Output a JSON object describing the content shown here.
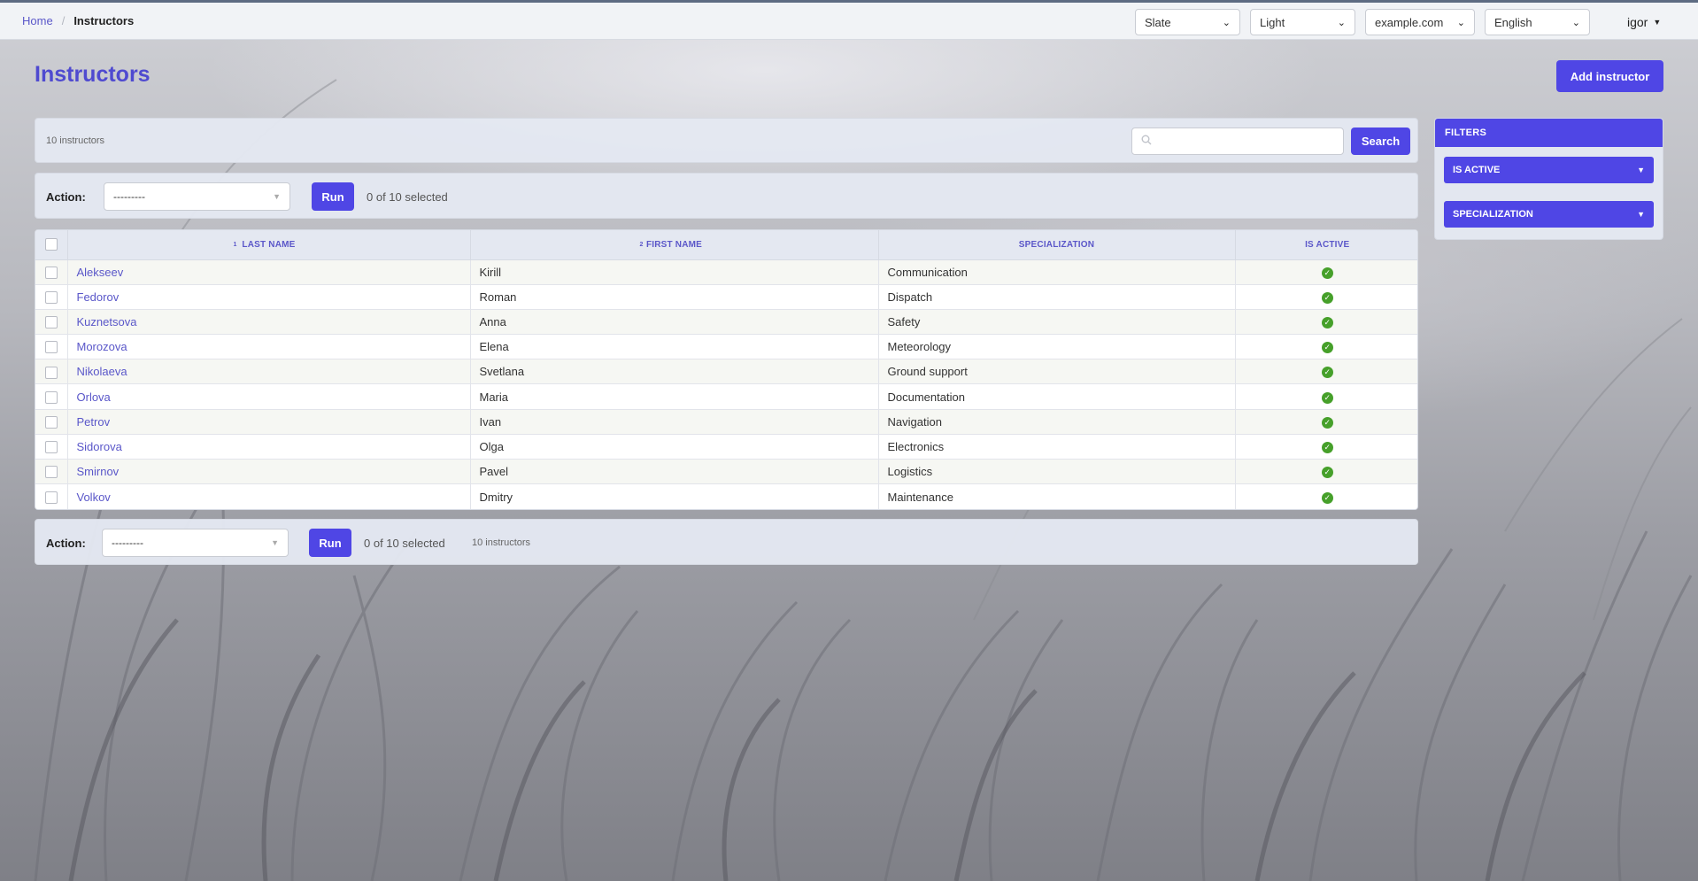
{
  "breadcrumb": {
    "home": "Home",
    "separator": "/",
    "current": "Instructors"
  },
  "topbar": {
    "theme_select": "Slate",
    "mode_select": "Light",
    "site_select": "example.com",
    "language_select": "English",
    "user": "igor"
  },
  "page": {
    "title": "Instructors",
    "add_button": "Add instructor"
  },
  "search": {
    "count": "10 instructors",
    "placeholder": "",
    "button": "Search"
  },
  "actions": {
    "label": "Action:",
    "selected_option": "---------",
    "run": "Run",
    "selected_count": "0 of 10 selected",
    "footer_count": "10 instructors"
  },
  "table": {
    "columns": {
      "last_name": "Last name",
      "last_name_sort": "1",
      "first_name": "First name",
      "first_name_sort": "2",
      "specialization": "Specialization",
      "is_active": "Is active"
    },
    "rows": [
      {
        "last": "Alekseev",
        "first": "Kirill",
        "spec": "Communication"
      },
      {
        "last": "Fedorov",
        "first": "Roman",
        "spec": "Dispatch"
      },
      {
        "last": "Kuznetsova",
        "first": "Anna",
        "spec": "Safety"
      },
      {
        "last": "Morozova",
        "first": "Elena",
        "spec": "Meteorology"
      },
      {
        "last": "Nikolaeva",
        "first": "Svetlana",
        "spec": "Ground support"
      },
      {
        "last": "Orlova",
        "first": "Maria",
        "spec": "Documentation"
      },
      {
        "last": "Petrov",
        "first": "Ivan",
        "spec": "Navigation"
      },
      {
        "last": "Sidorova",
        "first": "Olga",
        "spec": "Electronics"
      },
      {
        "last": "Smirnov",
        "first": "Pavel",
        "spec": "Logistics"
      },
      {
        "last": "Volkov",
        "first": "Dmitry",
        "spec": "Maintenance"
      }
    ]
  },
  "filters": {
    "title": "Filters",
    "items": [
      "Is active",
      "Specialization"
    ]
  },
  "colors": {
    "accent": "#4f46e5",
    "active_ok": "#46a02a",
    "link": "#5a57c9"
  },
  "icons": {
    "active": "check-circle-icon",
    "search": "search-icon",
    "dropdown": "chevron-down-icon"
  }
}
